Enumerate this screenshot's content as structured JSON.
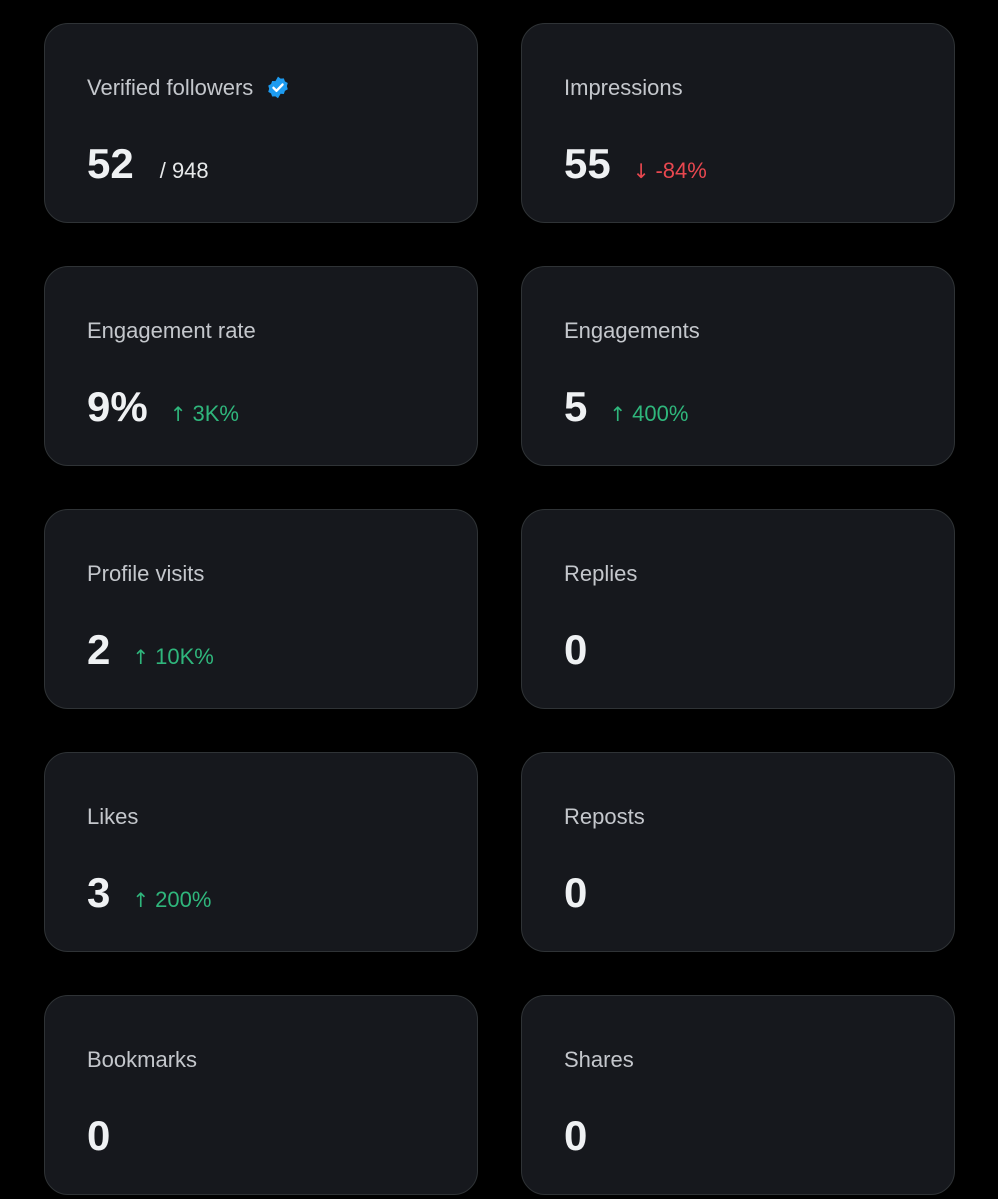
{
  "colors": {
    "background": "#000000",
    "card": "#16181d",
    "card_border": "#2f3336",
    "up": "#2fb67c",
    "down": "#e8474f",
    "verified": "#1d9bf0"
  },
  "cards": [
    {
      "title": "Verified followers",
      "value": "52",
      "total": "/ 948",
      "icon": "verified-badge-icon"
    },
    {
      "title": "Impressions",
      "value": "55",
      "change": "-84%",
      "direction": "down",
      "arrow": "↓"
    },
    {
      "title": "Engagement rate",
      "value": "9%",
      "change": "3K%",
      "direction": "up",
      "arrow": "↑"
    },
    {
      "title": "Engagements",
      "value": "5",
      "change": "400%",
      "direction": "up",
      "arrow": "↑"
    },
    {
      "title": "Profile visits",
      "value": "2",
      "change": "10K%",
      "direction": "up",
      "arrow": "↑"
    },
    {
      "title": "Replies",
      "value": "0"
    },
    {
      "title": "Likes",
      "value": "3",
      "change": "200%",
      "direction": "up",
      "arrow": "↑"
    },
    {
      "title": "Reposts",
      "value": "0"
    },
    {
      "title": "Bookmarks",
      "value": "0"
    },
    {
      "title": "Shares",
      "value": "0"
    }
  ]
}
